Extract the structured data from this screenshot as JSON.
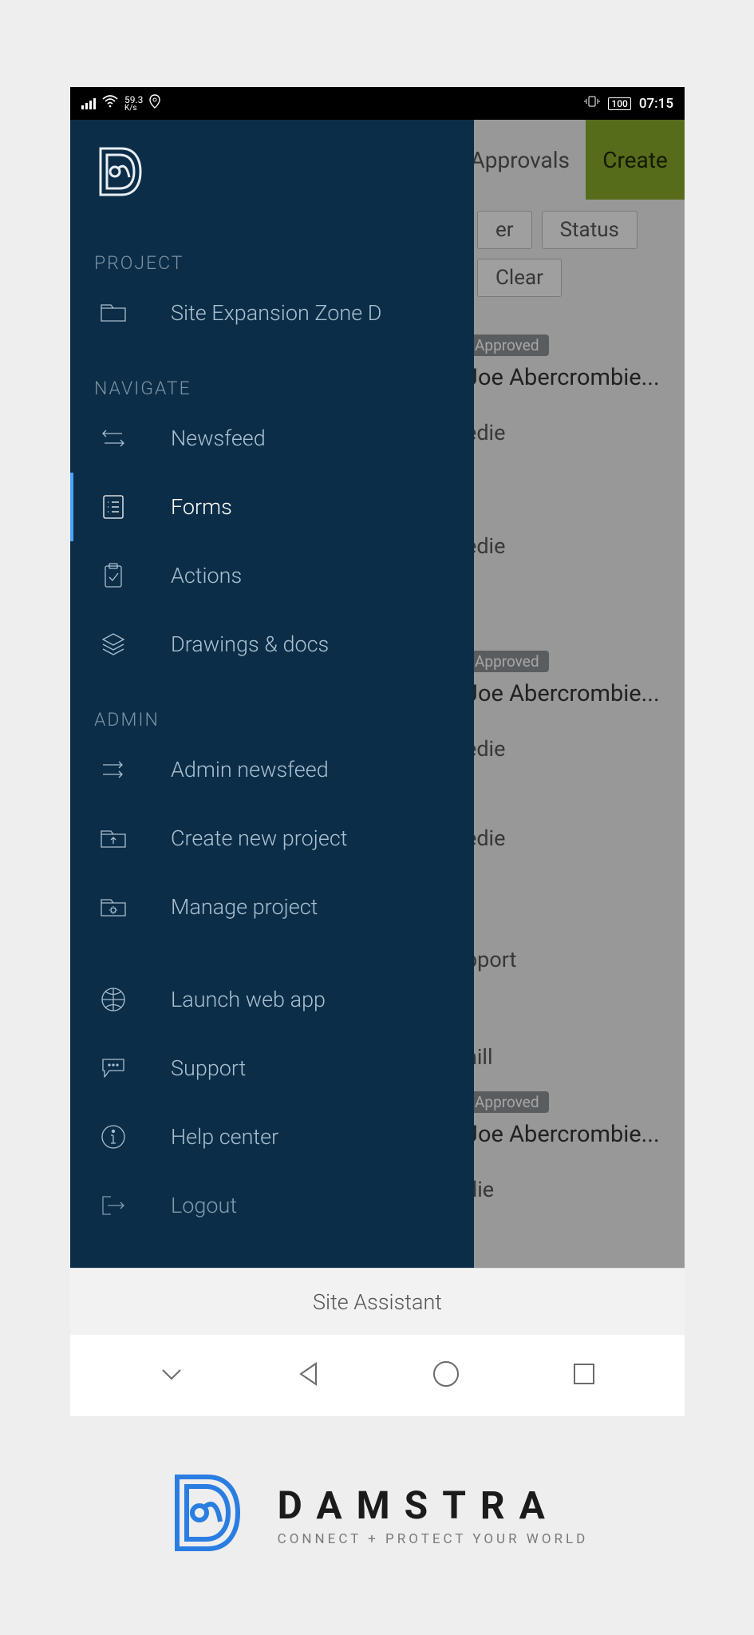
{
  "statusbar": {
    "speed_value": "59.3",
    "speed_unit": "K/s",
    "battery": "100",
    "time": "07:15"
  },
  "topbar": {
    "approvals": "Approvals",
    "create": "Create"
  },
  "filters": {
    "er": "er",
    "status": "Status",
    "clear": "Clear"
  },
  "cards": [
    {
      "badge": "Approved",
      "name": "Joe Abercrombie...",
      "sub": "edie"
    },
    {
      "badge": "",
      "name": "",
      "sub": "edie"
    },
    {
      "badge": "Approved",
      "name": "Joe Abercrombie...",
      "sub": "edie"
    },
    {
      "badge": "",
      "name": "",
      "sub": "edie"
    },
    {
      "badge": "",
      "name": "",
      "sub": "pport"
    },
    {
      "badge": "",
      "name": "",
      "sub": "hill"
    },
    {
      "badge": "Approved",
      "name": "Joe Abercrombie...",
      "sub": "die"
    }
  ],
  "drawer": {
    "project_label": "PROJECT",
    "project_name": "Site Expansion Zone D",
    "navigate_label": "NAVIGATE",
    "newsfeed": "Newsfeed",
    "forms": "Forms",
    "actions": "Actions",
    "drawings": "Drawings & docs",
    "admin_label": "ADMIN",
    "admin_newsfeed": "Admin newsfeed",
    "create_project": "Create new project",
    "manage_project": "Manage project",
    "launch_web": "Launch web app",
    "support": "Support",
    "help_center": "Help center",
    "logout": "Logout"
  },
  "footer": {
    "assistant": "Site Assistant"
  },
  "brand": {
    "name": "DAMSTRA",
    "tagline": "CONNECT + PROTECT YOUR WORLD"
  }
}
